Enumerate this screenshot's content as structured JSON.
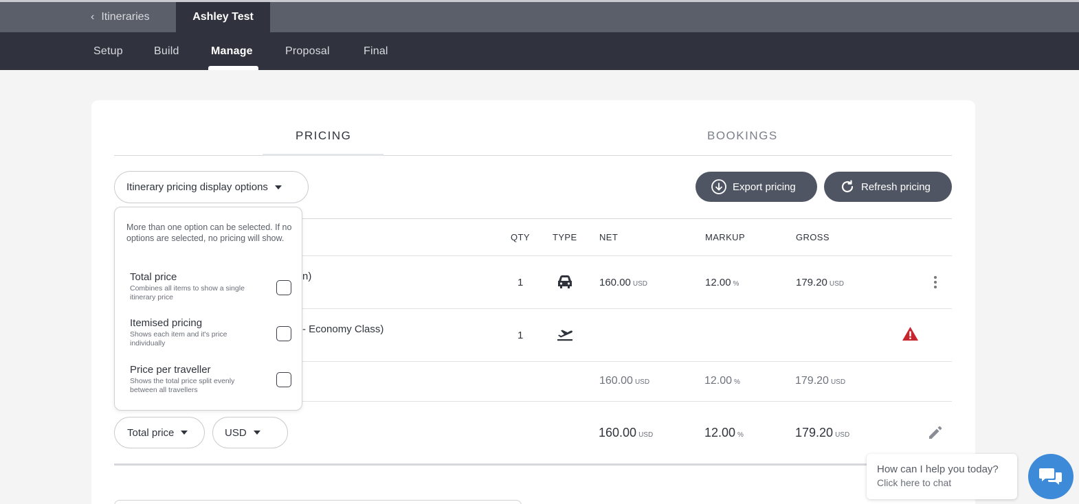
{
  "breadcrumb": {
    "back_label": "Itineraries",
    "current": "Ashley Test"
  },
  "nav": {
    "tabs": [
      {
        "label": "Setup"
      },
      {
        "label": "Build"
      },
      {
        "label": "Manage"
      },
      {
        "label": "Proposal"
      },
      {
        "label": "Final"
      }
    ],
    "active": "Manage"
  },
  "main_tabs": {
    "pricing": "PRICING",
    "bookings": "BOOKINGS",
    "active": "PRICING"
  },
  "toolbar": {
    "display_options_label": "Itinerary pricing display options",
    "export_label": "Export pricing",
    "refresh_label": "Refresh pricing"
  },
  "dropdown": {
    "note": "More than one option can be selected. If no options are selected, no pricing will show.",
    "options": [
      {
        "title": "Total price",
        "desc": "Combines all items to show a single itinerary price",
        "checked": false
      },
      {
        "title": "Itemised pricing",
        "desc": "Shows each item and it's price individually",
        "checked": false
      },
      {
        "title": "Price per traveller",
        "desc": "Shows the total price split evenly between all travellers",
        "checked": false
      }
    ]
  },
  "table": {
    "headers": {
      "qty": "QTY",
      "type": "TYPE",
      "net": "NET",
      "markup": "MARKUP",
      "gross": "GROSS"
    },
    "rows": [
      {
        "name_partial": "n)",
        "qty": "1",
        "type_icon": "car-icon",
        "net": "160.00",
        "net_unit": "USD",
        "markup": "12.00",
        "markup_unit": "%",
        "gross": "179.20",
        "gross_unit": "USD",
        "action_icon": "more-vertical-icon"
      },
      {
        "name_partial": "- Economy Class)",
        "qty": "1",
        "type_icon": "plane-departure-icon",
        "net": "",
        "markup": "",
        "gross": "",
        "action_icon": "warning-icon"
      }
    ],
    "subtotal": {
      "net": "160.00",
      "net_unit": "USD",
      "markup": "12.00",
      "markup_unit": "%",
      "gross": "179.20",
      "gross_unit": "USD"
    },
    "total": {
      "net": "160.00",
      "net_unit": "USD",
      "markup": "12.00",
      "markup_unit": "%",
      "gross": "179.20",
      "gross_unit": "USD",
      "action_icon": "pencil-icon"
    }
  },
  "footer_controls": {
    "price_type": "Total price",
    "currency": "USD"
  },
  "chat": {
    "line1": "How can I help you today?",
    "line2": "Click here to chat"
  },
  "colors": {
    "nav_dark": "#30333d",
    "breadcrumb_bar": "#5b5f6a",
    "button_dark": "#4f5563",
    "warning": "#c6262e",
    "chat_blue": "#3d8ad8"
  }
}
